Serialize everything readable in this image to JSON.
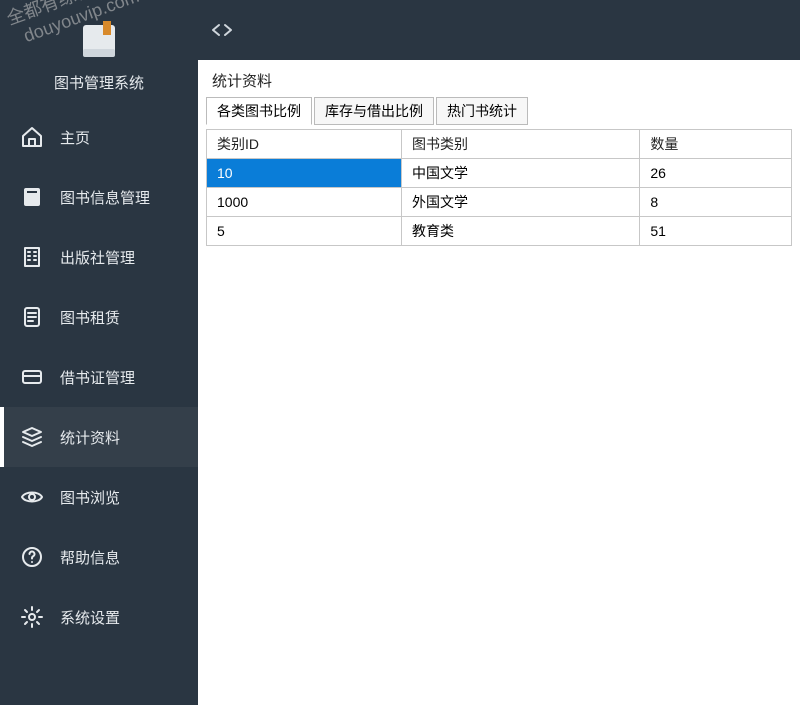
{
  "app_title": "图书管理系统",
  "watermark": "全都有综合资源网\n  douyouvip.com",
  "sidebar": {
    "items": [
      {
        "label": "主页",
        "icon": "home-icon"
      },
      {
        "label": "图书信息管理",
        "icon": "book-icon"
      },
      {
        "label": "出版社管理",
        "icon": "building-icon"
      },
      {
        "label": "图书租赁",
        "icon": "document-icon"
      },
      {
        "label": "借书证管理",
        "icon": "card-icon"
      },
      {
        "label": "统计资料",
        "icon": "stack-icon"
      },
      {
        "label": "图书浏览",
        "icon": "eye-icon"
      },
      {
        "label": "帮助信息",
        "icon": "help-icon"
      },
      {
        "label": "系统设置",
        "icon": "gear-icon"
      }
    ],
    "active_index": 5
  },
  "content": {
    "panel_title": "统计资料",
    "tabs": [
      {
        "label": "各类图书比例",
        "active": true
      },
      {
        "label": "库存与借出比例",
        "active": false
      },
      {
        "label": "热门书统计",
        "active": false
      }
    ],
    "table": {
      "columns": [
        "类别ID",
        "图书类别",
        "数量"
      ],
      "rows": [
        {
          "cells": [
            "10",
            "中国文学",
            "26"
          ],
          "selected": true
        },
        {
          "cells": [
            "1000",
            "外国文学",
            "8"
          ],
          "selected": false
        },
        {
          "cells": [
            "5",
            "教育类",
            "51"
          ],
          "selected": false
        }
      ]
    }
  }
}
